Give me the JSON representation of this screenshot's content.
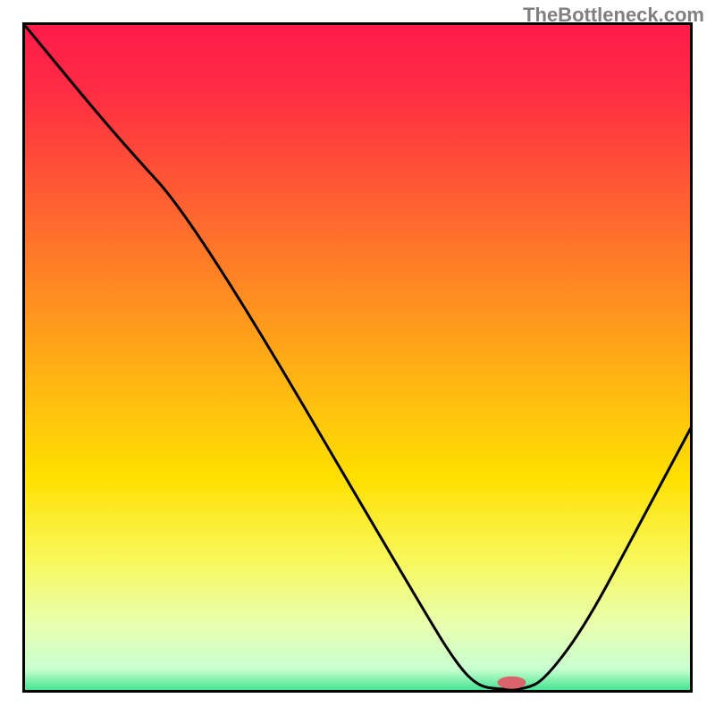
{
  "watermark": "TheBottleneck.com",
  "chart_data": {
    "type": "line",
    "title": "",
    "xlabel": "",
    "ylabel": "",
    "xlim": [
      0,
      100
    ],
    "ylim": [
      0,
      100
    ],
    "gradient_stops": [
      {
        "offset": 0,
        "color": "#ff1a4a"
      },
      {
        "offset": 0.1,
        "color": "#ff2b44"
      },
      {
        "offset": 0.25,
        "color": "#ff5a33"
      },
      {
        "offset": 0.4,
        "color": "#ff8a22"
      },
      {
        "offset": 0.55,
        "color": "#ffba11"
      },
      {
        "offset": 0.68,
        "color": "#ffe000"
      },
      {
        "offset": 0.8,
        "color": "#f8f85a"
      },
      {
        "offset": 0.9,
        "color": "#e8ffb0"
      },
      {
        "offset": 0.965,
        "color": "#c8ffd0"
      },
      {
        "offset": 1.0,
        "color": "#35e08a"
      }
    ],
    "curve_points": [
      {
        "x": 0,
        "y": 100
      },
      {
        "x": 14,
        "y": 83
      },
      {
        "x": 26,
        "y": 70
      },
      {
        "x": 60,
        "y": 12
      },
      {
        "x": 65,
        "y": 4
      },
      {
        "x": 68,
        "y": 1
      },
      {
        "x": 71,
        "y": 0.5
      },
      {
        "x": 75,
        "y": 0.5
      },
      {
        "x": 78,
        "y": 2
      },
      {
        "x": 84,
        "y": 10
      },
      {
        "x": 92,
        "y": 25
      },
      {
        "x": 100,
        "y": 40
      }
    ],
    "marker": {
      "x": 73,
      "y": 1.5,
      "color": "#d9636b",
      "rx": 16,
      "ry": 7
    },
    "border_color": "#000000",
    "border_width": 3
  }
}
